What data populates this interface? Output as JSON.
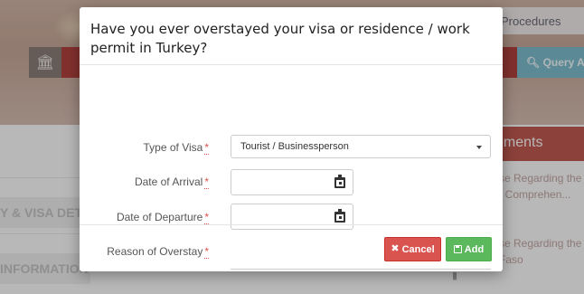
{
  "background": {
    "top_nav_item": "Procedures",
    "query_button": "Query App",
    "announcements_header": "ements",
    "announcements": [
      {
        "lines": [
          "se Regarding the",
          "t Comprehen..."
        ]
      },
      {
        "lines": [
          "se Regarding the",
          "Faso"
        ]
      }
    ],
    "left_sections": [
      "Y & VISA DETA",
      "INFORMATION"
    ]
  },
  "modal": {
    "title": "Have you ever overstayed your visa or residence / work permit in Turkey?",
    "fields": {
      "visa_type": {
        "label": "Type of Visa",
        "required_mark": "*",
        "value": "Tourist / Businessperson"
      },
      "arrival_date": {
        "label": "Date of Arrival",
        "required_mark": "*",
        "value": ""
      },
      "departure_date": {
        "label": "Date of Departure",
        "required_mark": "*",
        "value": ""
      },
      "reason": {
        "label": "Reason of Overstay",
        "required_mark": "*",
        "value": ""
      }
    },
    "buttons": {
      "cancel": "Cancel",
      "add": "Add"
    },
    "colors": {
      "cancel": "#d9534f",
      "add": "#5cb85c",
      "required": "#d9534f"
    }
  }
}
